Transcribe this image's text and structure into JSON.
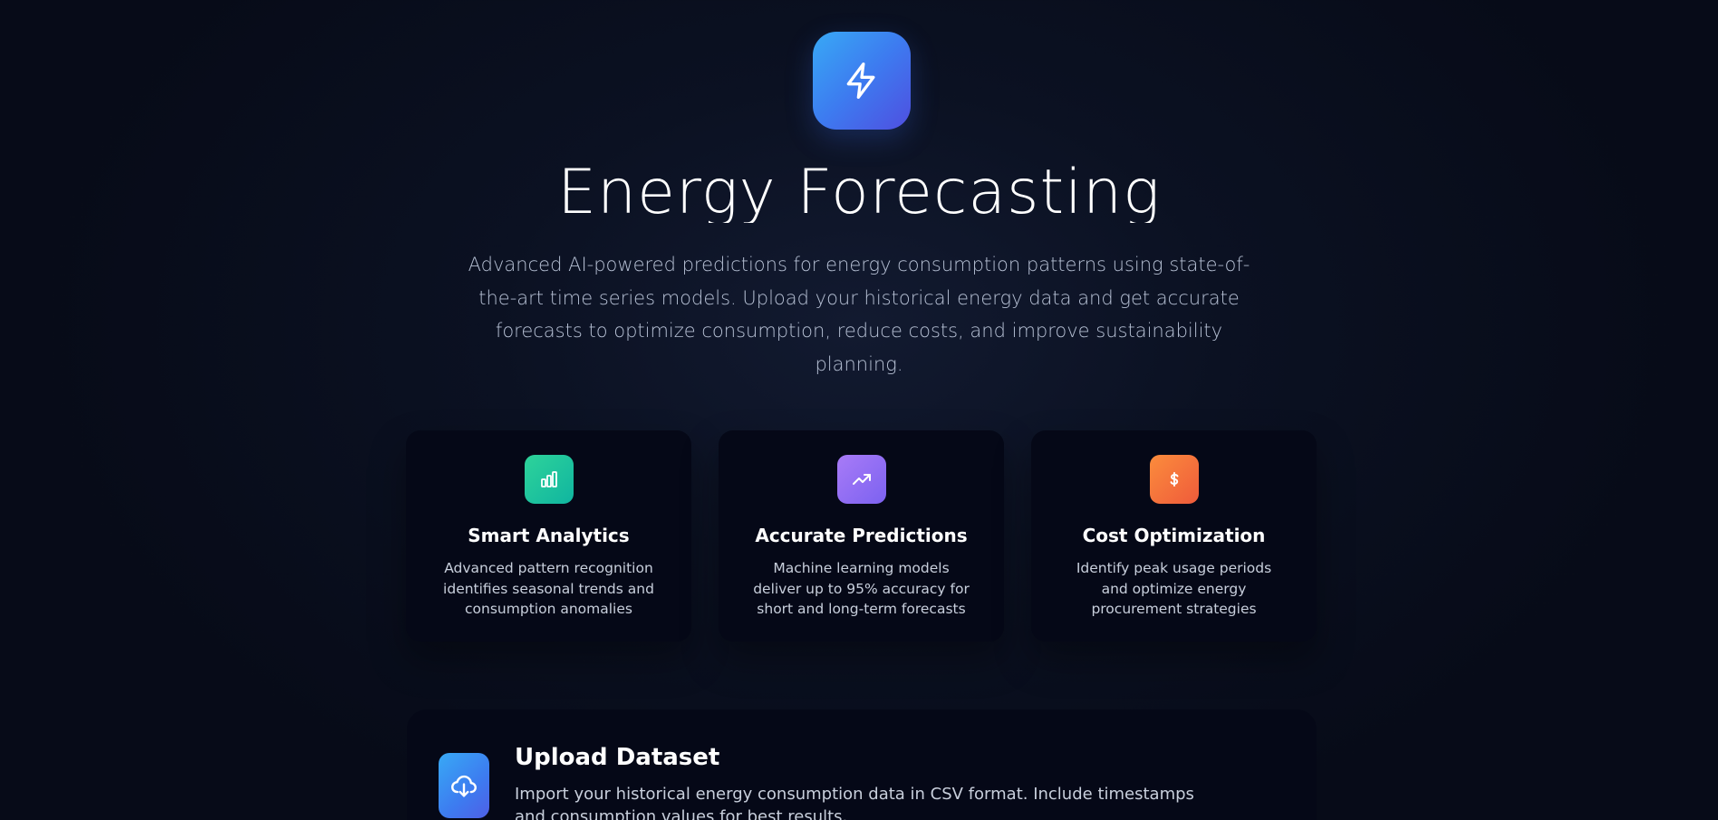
{
  "hero": {
    "icon": "lightning-bolt-icon",
    "title": "Energy Forecasting",
    "description": "Advanced AI-powered predictions for energy consumption patterns using state-of-the-art time series models. Upload your historical energy data and get accurate forecasts to optimize consumption, reduce costs, and improve sustainability planning."
  },
  "features": [
    {
      "icon": "bar-chart-icon",
      "color": "#10b981",
      "title": "Smart Analytics",
      "description": "Advanced pattern recognition identifies seasonal trends and consumption anomalies"
    },
    {
      "icon": "trending-up-icon",
      "color": "#8b5cf6",
      "title": "Accurate Predictions",
      "description": "Machine learning models deliver up to 95% accuracy for short and long-term forecasts"
    },
    {
      "icon": "dollar-sign-icon",
      "color": "#f97316",
      "title": "Cost Optimization",
      "description": "Identify peak usage periods and optimize energy procurement strategies"
    }
  ],
  "upload": {
    "icon": "cloud-download-icon",
    "title": "Upload Dataset",
    "description": "Import your historical energy consumption data in CSV format. Include timestamps and consumption values for best results."
  }
}
